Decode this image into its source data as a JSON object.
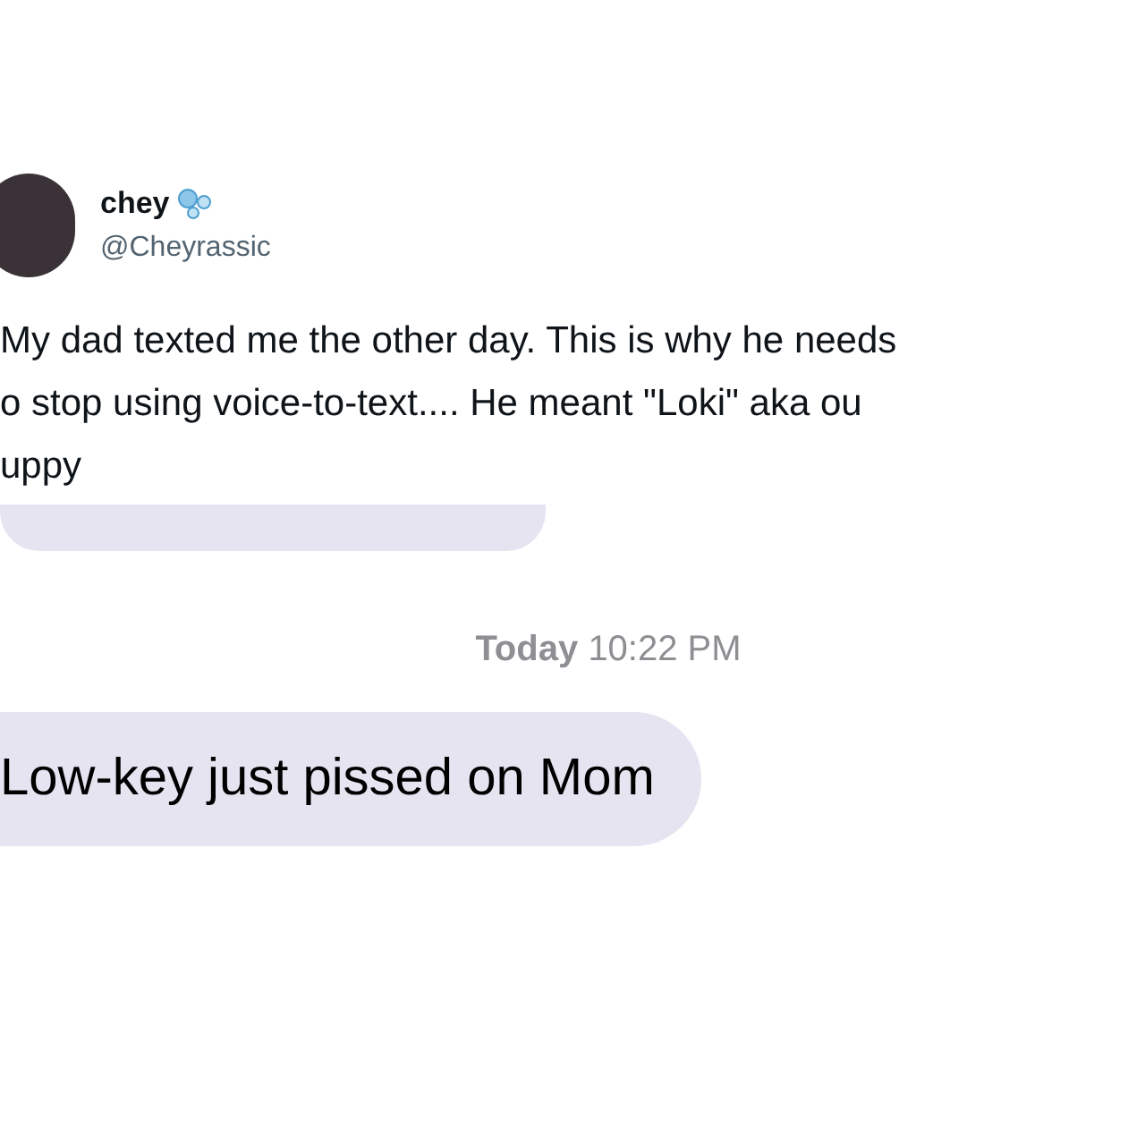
{
  "tweet": {
    "author": {
      "name": "chey",
      "handle": "@Cheyrassic"
    },
    "text_lines": [
      "My dad texted me the other day. This is why he needs",
      "o stop using voice-to-text.... He meant \"Loki\" aka ou",
      "uppy"
    ]
  },
  "conversation": {
    "timestamp": {
      "day": "Today",
      "time": "10:22 PM"
    },
    "messages": [
      {
        "text": "Low-key just pissed on Mom"
      }
    ]
  }
}
